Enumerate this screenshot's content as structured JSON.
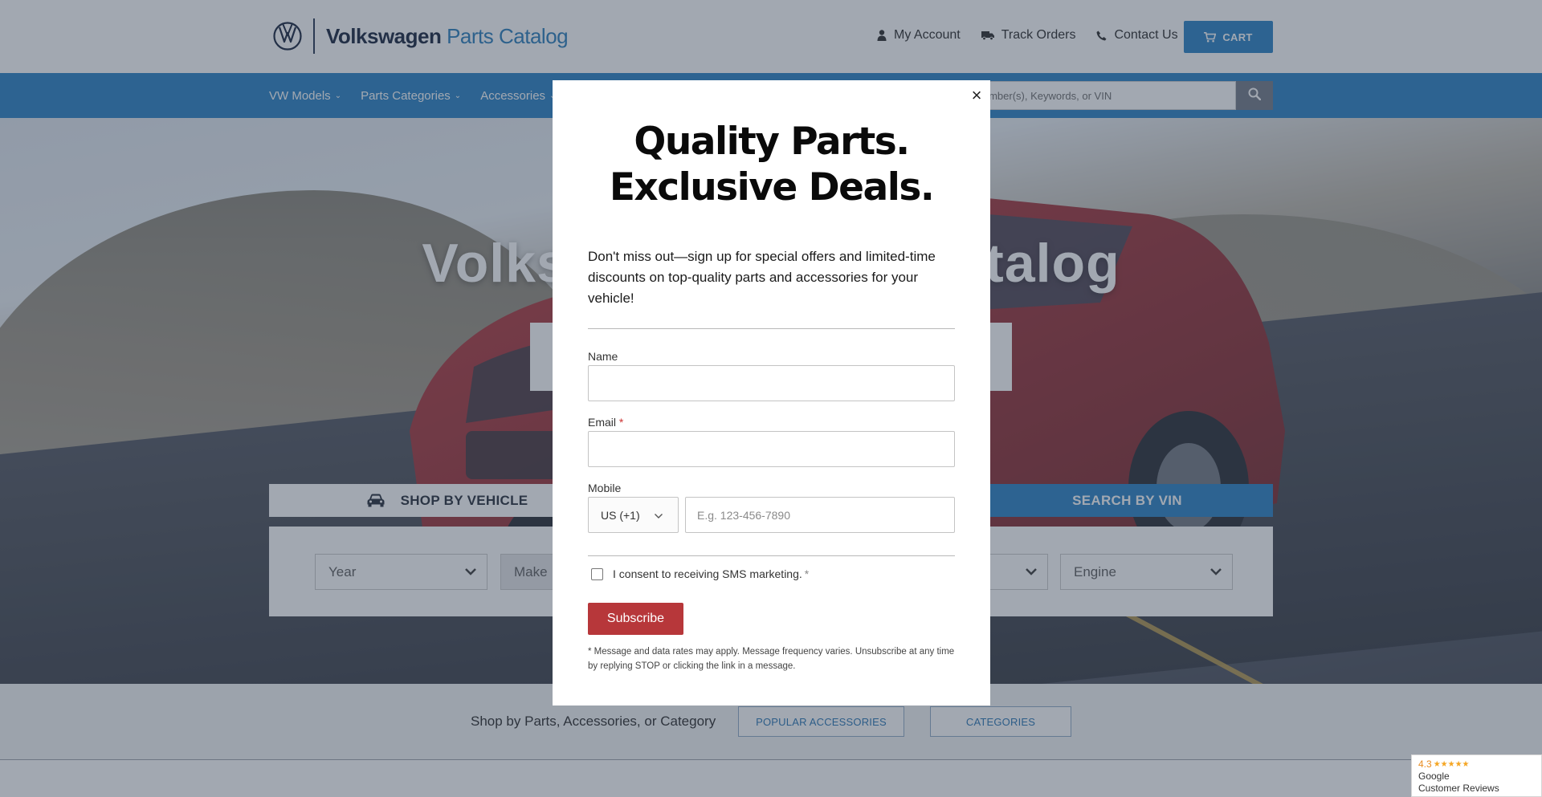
{
  "header": {
    "logo_brand": "Volkswagen",
    "logo_sub": "Parts Catalog",
    "links": [
      {
        "label": "My Account",
        "icon": "user-icon"
      },
      {
        "label": "Track Orders",
        "icon": "truck-icon"
      },
      {
        "label": "Contact Us",
        "icon": "phone-icon"
      }
    ],
    "cart_label": "CART"
  },
  "nav": {
    "items": [
      {
        "label": "VW Models"
      },
      {
        "label": "Parts Categories"
      },
      {
        "label": "Accessories"
      }
    ],
    "search_placeholder": "Part Number(s), Keywords, or VIN"
  },
  "hero": {
    "title": "Volkswagen Parts Catalog",
    "tab_vehicle": "SHOP BY VEHICLE",
    "tab_vin": "SEARCH BY VIN",
    "selectors": {
      "year": "Year",
      "make": "Make",
      "engine": "Engine"
    }
  },
  "shop_by": {
    "label": "Shop by Parts, Accessories, or Category",
    "popular": "POPULAR ACCESSORIES",
    "categories": "CATEGORIES"
  },
  "modal": {
    "headline_line1": "Quality Parts.",
    "headline_line2": "Exclusive Deals.",
    "description": "Don't miss out—sign up for special offers and limited-time discounts on top-quality parts and accessories for your vehicle!",
    "name_label": "Name",
    "email_label": "Email",
    "required_mark": "*",
    "mobile_label": "Mobile",
    "country_code": "US (+1)",
    "phone_placeholder": "E.g. 123-456-7890",
    "consent_label": "I consent to receiving SMS marketing.",
    "subscribe_label": "Subscribe",
    "fineprint": "* Message and data rates may apply. Message frequency varies. Unsubscribe at any time by replying STOP or clicking the link in a message.",
    "close_glyph": "×"
  },
  "google_badge": {
    "rating": "4.3",
    "stars": "★★★★★",
    "line1": "Google",
    "line2": "Customer Reviews"
  },
  "colors": {
    "brand_blue": "#1f7cc1",
    "subscribe_red": "#b7373a",
    "overlay": "rgba(60,74,92,0.48)"
  }
}
